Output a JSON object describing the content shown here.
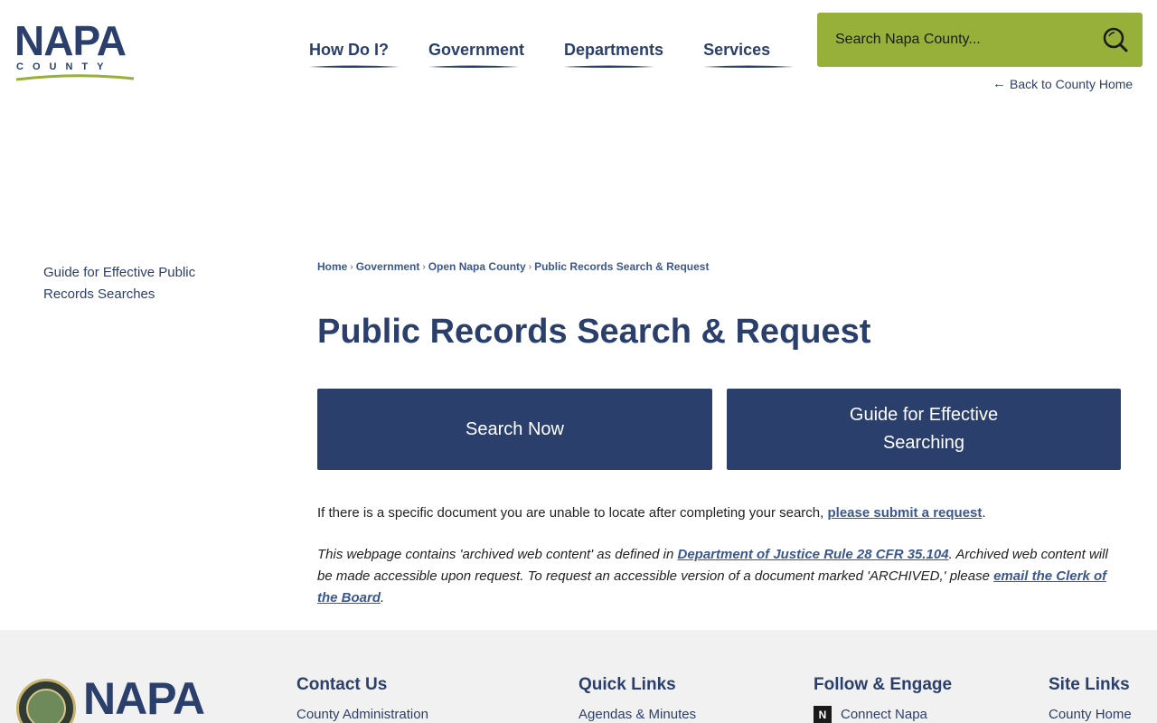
{
  "header": {
    "logo": {
      "word": "NAPA",
      "sub": "COUNTY"
    },
    "nav": [
      {
        "label": "How Do I?"
      },
      {
        "label": "Government"
      },
      {
        "label": "Departments"
      },
      {
        "label": "Services"
      }
    ],
    "search": {
      "placeholder": "Search Napa County..."
    },
    "back_link": "Back to County Home"
  },
  "sidebar": {
    "items": [
      {
        "label": "Guide for Effective Public Records Searches"
      }
    ]
  },
  "breadcrumb": [
    {
      "label": "Home"
    },
    {
      "label": "Government"
    },
    {
      "label": "Open Napa County"
    },
    {
      "label": "Public Records Search & Request"
    }
  ],
  "main": {
    "title": "Public Records Search & Request",
    "buttons": [
      {
        "label": "Search Now"
      },
      {
        "label": "Guide for Effective Searching"
      }
    ],
    "para1": {
      "text": "If there is a specific document you are unable to locate after completing your search, ",
      "link": "please submit a request",
      "end": "."
    },
    "para2": {
      "text1": "This webpage contains 'archived web content' as defined in ",
      "link1": "Department of Justice Rule 28 CFR 35.104",
      "text2": ". Archived web content will be made accessible upon request. To request an accessible version of a document marked 'ARCHIVED,' please ",
      "link2": "email the Clerk of the Board",
      "end": "."
    }
  },
  "footer": {
    "logo": "NAPA",
    "columns": [
      {
        "heading": "Contact Us",
        "first_item": "County Administration"
      },
      {
        "heading": "Quick Links",
        "first_item": "Agendas & Minutes"
      },
      {
        "heading": "Follow & Engage",
        "first_item": "Connect Napa"
      },
      {
        "heading": "Site Links",
        "first_item": "County Home"
      }
    ]
  },
  "colors": {
    "brand_navy": "#2b3f6c",
    "brand_green": "#97b03a",
    "footer_bg": "#f1f1f1"
  }
}
